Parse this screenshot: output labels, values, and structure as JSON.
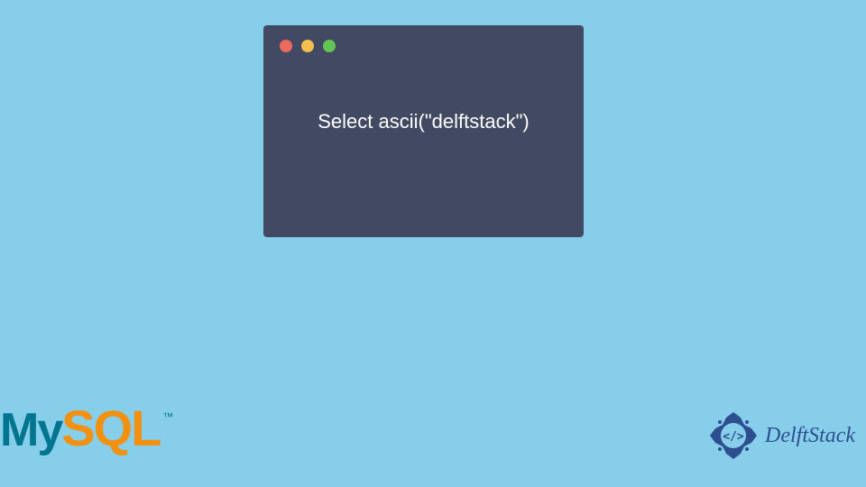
{
  "codeWindow": {
    "content": "Select ascii(\"delftstack\")"
  },
  "mysqlLogo": {
    "my": "My",
    "sql": "SQL",
    "tm": "™"
  },
  "delftstackLogo": {
    "text": "DelftStack"
  },
  "colors": {
    "background": "#87ceeb",
    "codeWindow": "#424a63",
    "mysqlTeal": "#00758f",
    "mysqlOrange": "#f29111",
    "delftstackBlue": "#2d4f8f"
  }
}
